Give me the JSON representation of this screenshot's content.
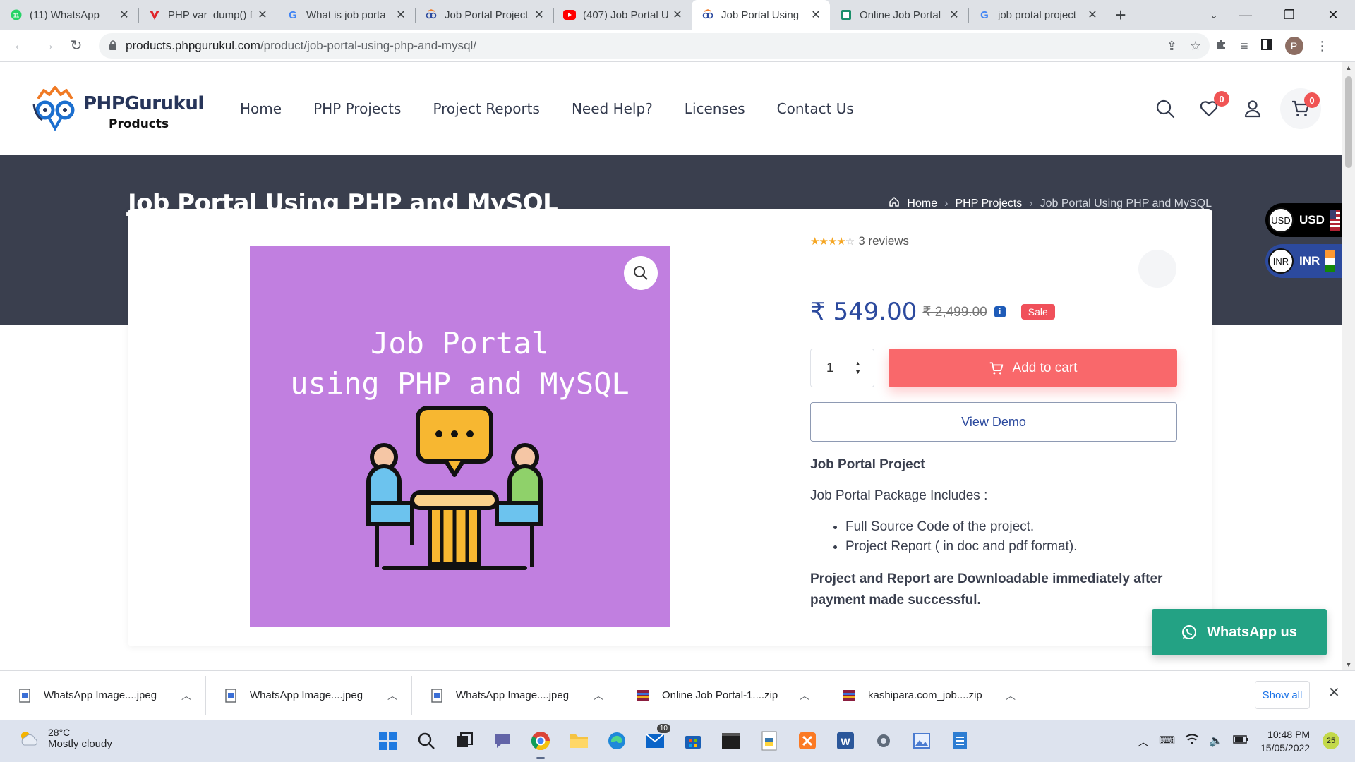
{
  "browser": {
    "tabs": [
      {
        "title": "(11) WhatsApp",
        "icon": "whatsapp-icon",
        "color": "#25d366"
      },
      {
        "title": "PHP var_dump() f",
        "icon": "vivaldi-icon",
        "color": "#e0242a"
      },
      {
        "title": "What is job porta",
        "icon": "google-icon",
        "color": "#4285f4"
      },
      {
        "title": "Job Portal Project",
        "icon": "phpgurukul-icon",
        "color": "#2c4a9e"
      },
      {
        "title": "(407) Job Portal U",
        "icon": "youtube-icon",
        "color": "#ff0000"
      },
      {
        "title": "Job Portal Using",
        "icon": "phpgurukul-icon",
        "color": "#2c4a9e"
      },
      {
        "title": "Online Job Portal",
        "icon": "site-icon",
        "color": "#1a8f6a"
      },
      {
        "title": "job protal project",
        "icon": "google-icon",
        "color": "#4285f4"
      }
    ],
    "active_tab": 5,
    "url_host": "products.phpgurukul.com",
    "url_path": "/product/job-portal-using-php-and-mysql/",
    "profile_initial": "P"
  },
  "site": {
    "logo_brand": "PHPGurukul",
    "logo_sub": "Products",
    "nav": [
      "Home",
      "PHP Projects",
      "Project Reports",
      "Need Help?",
      "Licenses",
      "Contact Us"
    ],
    "wishlist_count": "0",
    "cart_count": "0"
  },
  "page": {
    "title": "Job Portal Using PHP and MySQL",
    "breadcrumb": {
      "home": "Home",
      "category": "PHP Projects",
      "current": "Job Portal Using PHP and MySQL"
    }
  },
  "product": {
    "image_text_line1": "Job Portal",
    "image_text_line2": "using PHP and MySQL",
    "image_bg": "#c17fe0",
    "rating": 4,
    "rating_max": 5,
    "reviews": "3 reviews",
    "price_new": "₹ 549.00",
    "price_old": "₹ 2,499.00",
    "info_badge": "i",
    "sale_label": "Sale",
    "quantity": "1",
    "add_to_cart": "Add to cart",
    "view_demo": "View Demo",
    "desc_heading": "Job Portal Project",
    "desc_intro": "Job Portal Package Includes :",
    "desc_items": [
      "Full Source Code of the project.",
      "Project Report ( in doc and pdf format)."
    ],
    "desc_note": "Project and Report are Downloadable immediately after payment made successful."
  },
  "currency": {
    "usd_code": "USD",
    "usd_label": "USD",
    "inr_code": "INR",
    "inr_label": "INR"
  },
  "whatsapp_label": "WhatsApp us",
  "downloads": {
    "items": [
      {
        "name": "WhatsApp Image....jpeg",
        "icon": "image-file-icon"
      },
      {
        "name": "WhatsApp Image....jpeg",
        "icon": "image-file-icon"
      },
      {
        "name": "WhatsApp Image....jpeg",
        "icon": "image-file-icon"
      },
      {
        "name": "Online Job Portal-1....zip",
        "icon": "zip-file-icon"
      },
      {
        "name": "kashipara.com_job....zip",
        "icon": "zip-file-icon"
      }
    ],
    "show_all": "Show all"
  },
  "taskbar": {
    "temperature": "28°C",
    "weather": "Mostly cloudy",
    "mail_badge": "10",
    "time": "10:48 PM",
    "date": "15/05/2022",
    "notifications": "25"
  },
  "colors": {
    "banner": "#3a3f4e",
    "accent_blue": "#2c4a9e",
    "cart_button": "#f9686b",
    "sale": "#f0505a",
    "whatsapp": "#23a284"
  }
}
